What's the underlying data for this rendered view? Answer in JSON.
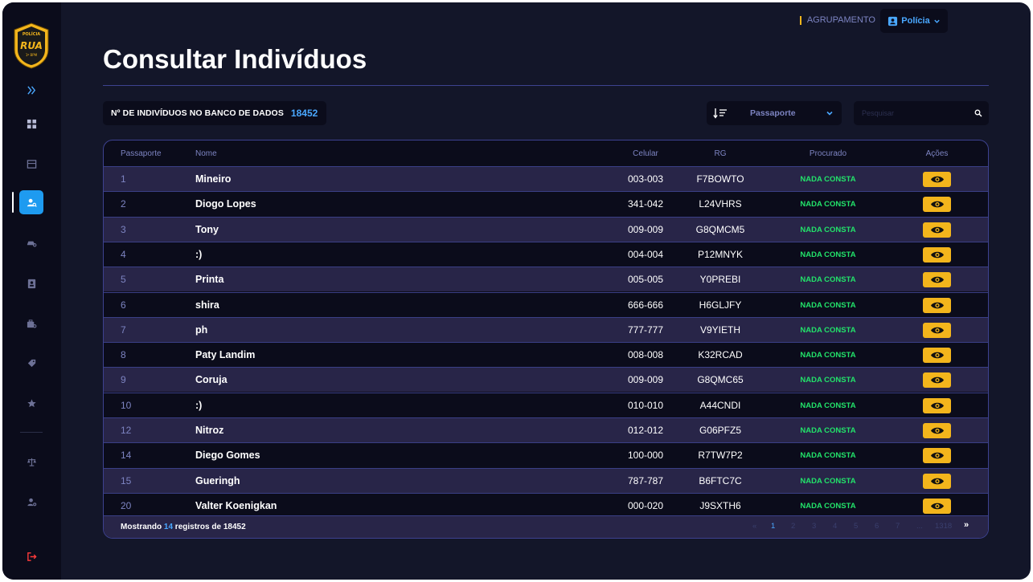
{
  "logo": {
    "top_text": "POLÍCIA",
    "main_text": "RUA",
    "bottom_text": "1º BPM"
  },
  "header": {
    "group_label": "AGRUPAMENTO",
    "group_value": "Polícia"
  },
  "page_title": "Consultar Indivíduos",
  "count": {
    "label": "Nº DE INDIVÍDUOS NO BANCO DE DADOS",
    "value": "18452"
  },
  "sort": {
    "selected": "Passaporte"
  },
  "search": {
    "placeholder": "Pesquisar"
  },
  "table": {
    "headers": {
      "passport": "Passaporte",
      "name": "Nome",
      "phone": "Celular",
      "rg": "RG",
      "wanted": "Procurado",
      "actions": "Ações"
    },
    "rows": [
      {
        "passport": "1",
        "name": "Mineiro",
        "phone": "003-003",
        "rg": "F7BOWTO",
        "wanted": "NADA CONSTA"
      },
      {
        "passport": "2",
        "name": "Diogo Lopes",
        "phone": "341-042",
        "rg": "L24VHRS",
        "wanted": "NADA CONSTA"
      },
      {
        "passport": "3",
        "name": "Tony",
        "phone": "009-009",
        "rg": "G8QMCM5",
        "wanted": "NADA CONSTA"
      },
      {
        "passport": "4",
        "name": ":)",
        "phone": "004-004",
        "rg": "P12MNYK",
        "wanted": "NADA CONSTA"
      },
      {
        "passport": "5",
        "name": "Printa",
        "phone": "005-005",
        "rg": "Y0PREBI",
        "wanted": "NADA CONSTA"
      },
      {
        "passport": "6",
        "name": "shira",
        "phone": "666-666",
        "rg": "H6GLJFY",
        "wanted": "NADA CONSTA"
      },
      {
        "passport": "7",
        "name": "ph",
        "phone": "777-777",
        "rg": "V9YIETH",
        "wanted": "NADA CONSTA"
      },
      {
        "passport": "8",
        "name": "Paty Landim",
        "phone": "008-008",
        "rg": "K32RCAD",
        "wanted": "NADA CONSTA"
      },
      {
        "passport": "9",
        "name": "Coruja",
        "phone": "009-009",
        "rg": "G8QMC65",
        "wanted": "NADA CONSTA"
      },
      {
        "passport": "10",
        "name": ":)",
        "phone": "010-010",
        "rg": "A44CNDI",
        "wanted": "NADA CONSTA"
      },
      {
        "passport": "12",
        "name": "Nitroz",
        "phone": "012-012",
        "rg": "G06PFZ5",
        "wanted": "NADA CONSTA"
      },
      {
        "passport": "14",
        "name": "Diego Gomes",
        "phone": "100-000",
        "rg": "R7TW7P2",
        "wanted": "NADA CONSTA"
      },
      {
        "passport": "15",
        "name": "Gueringh",
        "phone": "787-787",
        "rg": "B6FTC7C",
        "wanted": "NADA CONSTA"
      },
      {
        "passport": "20",
        "name": "Valter Koenigkan",
        "phone": "000-020",
        "rg": "J9SXTH6",
        "wanted": "NADA CONSTA"
      }
    ]
  },
  "footer": {
    "showing_prefix": "Mostrando",
    "showing_count": "14",
    "showing_mid": "registros de",
    "showing_total": "18452",
    "pages": [
      "«",
      "1",
      "2",
      "3",
      "4",
      "5",
      "6",
      "7",
      "...",
      "1318",
      "»"
    ]
  },
  "colors": {
    "accent_blue": "#1e9bf0",
    "gold": "#f3b51c",
    "ok_green": "#22e36a",
    "bg": "#131629"
  }
}
